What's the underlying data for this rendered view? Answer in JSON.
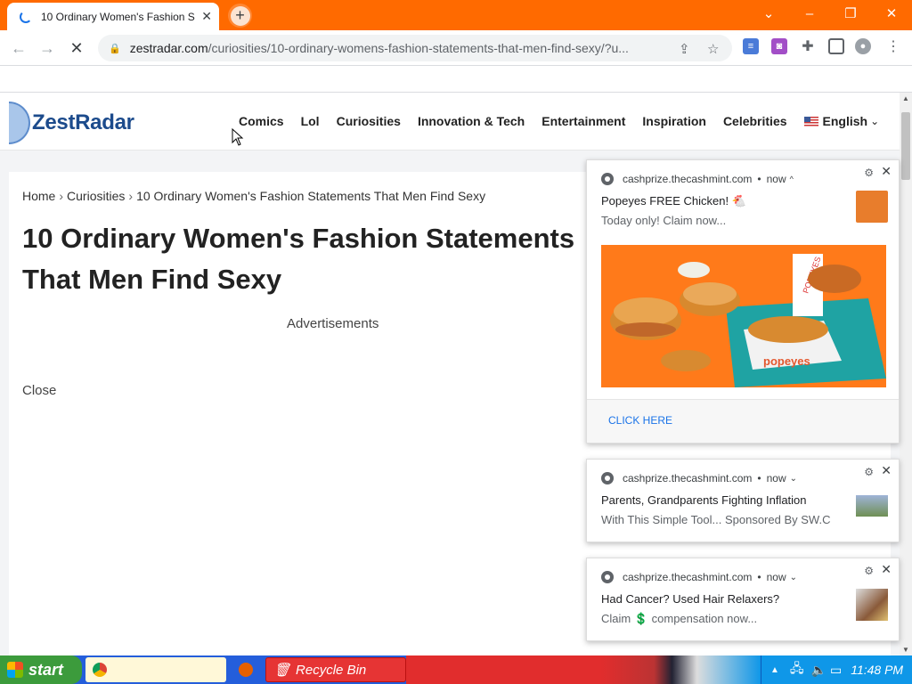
{
  "browser": {
    "tab_title": "10 Ordinary Women's Fashion S",
    "new_tab_symbol": "+",
    "url_host": "zestradar.com",
    "url_path": "/curiosities/10-ordinary-womens-fashion-statements-that-men-find-sexy/?u...",
    "window": {
      "minimize": "–",
      "restore": "❐",
      "close": "✕"
    },
    "nav_icons": {
      "back": "←",
      "forward": "→",
      "stop": "✕"
    }
  },
  "site": {
    "logo_text": "ZestRadar",
    "nav": [
      "Comics",
      "Lol",
      "Curiosities",
      "Innovation & Tech",
      "Entertainment",
      "Inspiration",
      "Celebrities"
    ],
    "language": "English"
  },
  "article": {
    "breadcrumb": [
      "Home",
      "Curiosities",
      "10 Ordinary Women's Fashion Statements That Men Find Sexy"
    ],
    "title_line1": "10 Ordinary Women's Fashion Statements",
    "title_line2": "That Men Find Sexy",
    "ads_label": "Advertisements",
    "close_label": "Close"
  },
  "notifications": [
    {
      "source": "cashprize.thecashmint.com",
      "time": "now",
      "title": "Popeyes FREE Chicken! 🐔",
      "body": "Today only! Claim now...",
      "cta": "CLICK HERE",
      "image_text": "popeyes",
      "cup_text": "POPEYES"
    },
    {
      "source": "cashprize.thecashmint.com",
      "time": "now",
      "title": "Parents, Grandparents Fighting Inflation",
      "body": "With This Simple Tool... Sponsored By SW.C"
    },
    {
      "source": "cashprize.thecashmint.com",
      "time": "now",
      "title": "Had Cancer? Used Hair Relaxers?",
      "body": "Claim 💲 compensation now..."
    }
  ],
  "taskbar": {
    "start": "start",
    "recycle_bin": "Recycle Bin",
    "time": "11:48 PM"
  },
  "colors": {
    "tabstrip": "#ff6a00",
    "logo": "#1c4b8c",
    "taskbar": "#245edb",
    "start": "#3c9b3c"
  }
}
